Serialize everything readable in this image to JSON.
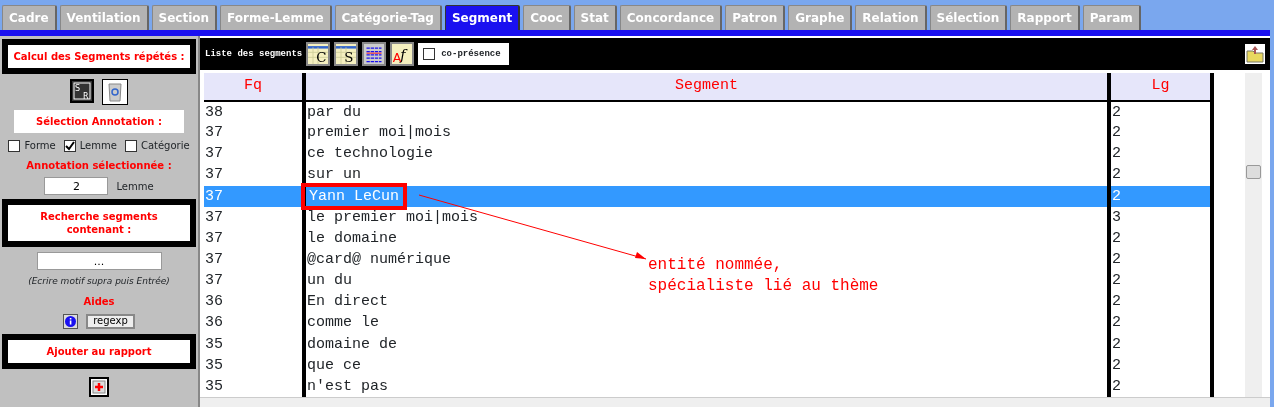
{
  "tabs": [
    {
      "label": "Cadre",
      "selected": false
    },
    {
      "label": "Ventilation",
      "selected": false
    },
    {
      "label": "Section",
      "selected": false
    },
    {
      "label": "Forme-Lemme",
      "selected": false
    },
    {
      "label": "Catégorie-Tag",
      "selected": false
    },
    {
      "label": "Segment",
      "selected": true
    },
    {
      "label": "Cooc",
      "selected": false
    },
    {
      "label": "Stat",
      "selected": false
    },
    {
      "label": "Concordance",
      "selected": false
    },
    {
      "label": "Patron",
      "selected": false
    },
    {
      "label": "Graphe",
      "selected": false
    },
    {
      "label": "Relation",
      "selected": false
    },
    {
      "label": "Sélection",
      "selected": false
    },
    {
      "label": "Rapport",
      "selected": false
    },
    {
      "label": "Param",
      "selected": false
    }
  ],
  "left_panel": {
    "calc_title": "Calcul des Segments répétés :",
    "calc_icon_letters": [
      "S",
      "R"
    ],
    "annotation_title": "Sélection Annotation :",
    "annotation_options": [
      {
        "label": "Forme",
        "checked": false
      },
      {
        "label": "Lemme",
        "checked": true
      },
      {
        "label": "Catégorie",
        "checked": false
      }
    ],
    "selected_annotation_label": "Annotation sélectionnée :",
    "selected_annotation_value": "2",
    "selected_annotation_name": "Lemme",
    "search_title": "Recherche segments contenant :",
    "search_value": "...",
    "search_hint": "(Ecrire motif supra puis Entrée)",
    "help_title": "Aides",
    "regexp_button": "regexp",
    "report_title": "Ajouter au rapport"
  },
  "toolbar": {
    "title": "Liste des segments",
    "buttons": [
      {
        "kind": "grid",
        "glyphs": [
          "C"
        ]
      },
      {
        "kind": "grid",
        "glyphs": [
          "S"
        ]
      },
      {
        "kind": "lines"
      },
      {
        "kind": "font",
        "glyphs": [
          "A",
          "f"
        ]
      }
    ],
    "copresence": {
      "label": "co-présence",
      "checked": false
    }
  },
  "table": {
    "columns": [
      "Fq",
      "Segment",
      "Lg"
    ],
    "rows": [
      {
        "fq": "38",
        "segment": "par du",
        "lg": "2",
        "selected": false,
        "boxed": false
      },
      {
        "fq": "37",
        "segment": "premier moi|mois",
        "lg": "2",
        "selected": false,
        "boxed": false
      },
      {
        "fq": "37",
        "segment": "ce technologie",
        "lg": "2",
        "selected": false,
        "boxed": false
      },
      {
        "fq": "37",
        "segment": "sur un",
        "lg": "2",
        "selected": false,
        "boxed": false
      },
      {
        "fq": "37",
        "segment": "Yann LeCun",
        "lg": "2",
        "selected": true,
        "boxed": true
      },
      {
        "fq": "37",
        "segment": "le premier moi|mois",
        "lg": "3",
        "selected": false,
        "boxed": false
      },
      {
        "fq": "37",
        "segment": "le domaine",
        "lg": "2",
        "selected": false,
        "boxed": false
      },
      {
        "fq": "37",
        "segment": "@card@ numérique",
        "lg": "2",
        "selected": false,
        "boxed": false
      },
      {
        "fq": "37",
        "segment": "un du",
        "lg": "2",
        "selected": false,
        "boxed": false
      },
      {
        "fq": "36",
        "segment": "En direct",
        "lg": "2",
        "selected": false,
        "boxed": false
      },
      {
        "fq": "36",
        "segment": "comme le",
        "lg": "2",
        "selected": false,
        "boxed": false
      },
      {
        "fq": "35",
        "segment": "domaine de",
        "lg": "2",
        "selected": false,
        "boxed": false
      },
      {
        "fq": "35",
        "segment": "que ce",
        "lg": "2",
        "selected": false,
        "boxed": false
      },
      {
        "fq": "35",
        "segment": "n'est pas",
        "lg": "2",
        "selected": false,
        "boxed": false
      }
    ]
  },
  "annotation": {
    "lines": [
      "entité nommée,",
      "spécialiste lié au thème"
    ]
  }
}
